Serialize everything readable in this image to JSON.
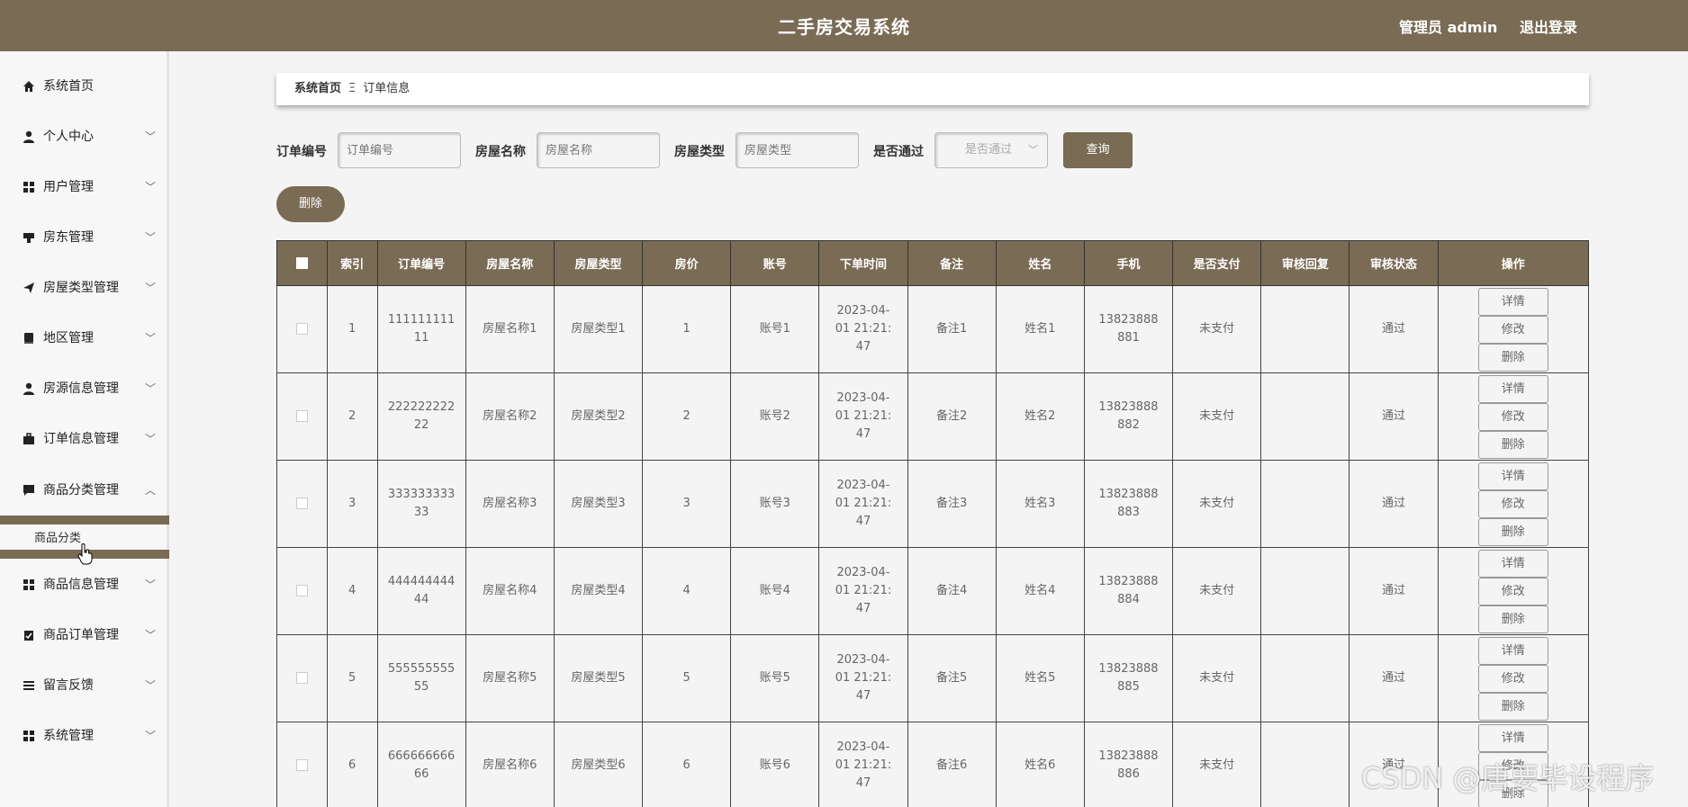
{
  "header": {
    "title": "二手房交易系统",
    "user": "管理员 admin",
    "logout": "退出登录"
  },
  "sidebar": {
    "items": [
      {
        "label": "系统首页",
        "icon": "home-icon"
      },
      {
        "label": "个人中心",
        "icon": "user-icon"
      },
      {
        "label": "用户管理",
        "icon": "grid-icon"
      },
      {
        "label": "房东管理",
        "icon": "stamp-icon"
      },
      {
        "label": "房屋类型管理",
        "icon": "send-icon"
      },
      {
        "label": "地区管理",
        "icon": "book-icon"
      },
      {
        "label": "房源信息管理",
        "icon": "user-icon"
      },
      {
        "label": "订单信息管理",
        "icon": "briefcase-icon"
      },
      {
        "label": "商品分类管理",
        "icon": "chat-icon"
      },
      {
        "label": "商品信息管理",
        "icon": "grid-icon"
      },
      {
        "label": "商品订单管理",
        "icon": "clipboard-icon"
      },
      {
        "label": "留言反馈",
        "icon": "list-icon"
      },
      {
        "label": "系统管理",
        "icon": "grid-icon"
      }
    ],
    "submenu": {
      "label": "商品分类"
    }
  },
  "breadcrumb": {
    "home": "系统首页",
    "sep": "Ξ",
    "current": "订单信息"
  },
  "search": {
    "order_no_label": "订单编号",
    "order_no_placeholder": "订单编号",
    "house_name_label": "房屋名称",
    "house_name_placeholder": "房屋名称",
    "house_type_label": "房屋类型",
    "house_type_placeholder": "房屋类型",
    "passed_label": "是否通过",
    "passed_placeholder": "是否通过",
    "query": "查询"
  },
  "actions": {
    "delete": "删除"
  },
  "table": {
    "headers": [
      "索引",
      "订单编号",
      "房屋名称",
      "房屋类型",
      "房价",
      "账号",
      "下单时间",
      "备注",
      "姓名",
      "手机",
      "是否支付",
      "审核回复",
      "审核状态",
      "操作"
    ],
    "rows": [
      {
        "idx": "1",
        "no1": "111111111",
        "no2": "11",
        "name": "房屋名称1",
        "type": "房屋类型1",
        "price": "1",
        "acct": "账号1",
        "t1": "2023-04-",
        "t2": "01 21:21:",
        "t3": "47",
        "note": "备注1",
        "person": "姓名1",
        "p1": "13823888",
        "p2": "881",
        "paid": "未支付",
        "reply": "",
        "status": "通过"
      },
      {
        "idx": "2",
        "no1": "222222222",
        "no2": "22",
        "name": "房屋名称2",
        "type": "房屋类型2",
        "price": "2",
        "acct": "账号2",
        "t1": "2023-04-",
        "t2": "01 21:21:",
        "t3": "47",
        "note": "备注2",
        "person": "姓名2",
        "p1": "13823888",
        "p2": "882",
        "paid": "未支付",
        "reply": "",
        "status": "通过"
      },
      {
        "idx": "3",
        "no1": "333333333",
        "no2": "33",
        "name": "房屋名称3",
        "type": "房屋类型3",
        "price": "3",
        "acct": "账号3",
        "t1": "2023-04-",
        "t2": "01 21:21:",
        "t3": "47",
        "note": "备注3",
        "person": "姓名3",
        "p1": "13823888",
        "p2": "883",
        "paid": "未支付",
        "reply": "",
        "status": "通过"
      },
      {
        "idx": "4",
        "no1": "444444444",
        "no2": "44",
        "name": "房屋名称4",
        "type": "房屋类型4",
        "price": "4",
        "acct": "账号4",
        "t1": "2023-04-",
        "t2": "01 21:21:",
        "t3": "47",
        "note": "备注4",
        "person": "姓名4",
        "p1": "13823888",
        "p2": "884",
        "paid": "未支付",
        "reply": "",
        "status": "通过"
      },
      {
        "idx": "5",
        "no1": "555555555",
        "no2": "55",
        "name": "房屋名称5",
        "type": "房屋类型5",
        "price": "5",
        "acct": "账号5",
        "t1": "2023-04-",
        "t2": "01 21:21:",
        "t3": "47",
        "note": "备注5",
        "person": "姓名5",
        "p1": "13823888",
        "p2": "885",
        "paid": "未支付",
        "reply": "",
        "status": "通过"
      },
      {
        "idx": "6",
        "no1": "666666666",
        "no2": "66",
        "name": "房屋名称6",
        "type": "房屋类型6",
        "price": "6",
        "acct": "账号6",
        "t1": "2023-04-",
        "t2": "01 21:21:",
        "t3": "47",
        "note": "备注6",
        "person": "姓名6",
        "p1": "13823888",
        "p2": "886",
        "paid": "未支付",
        "reply": "",
        "status": "通过"
      }
    ],
    "ops": {
      "detail": "详情",
      "edit": "修改",
      "delete": "删除"
    }
  },
  "watermark": "CSDN @唐要毕设程序",
  "colors": {
    "brand": "#7a6b55",
    "background": "#f4f4f4"
  }
}
